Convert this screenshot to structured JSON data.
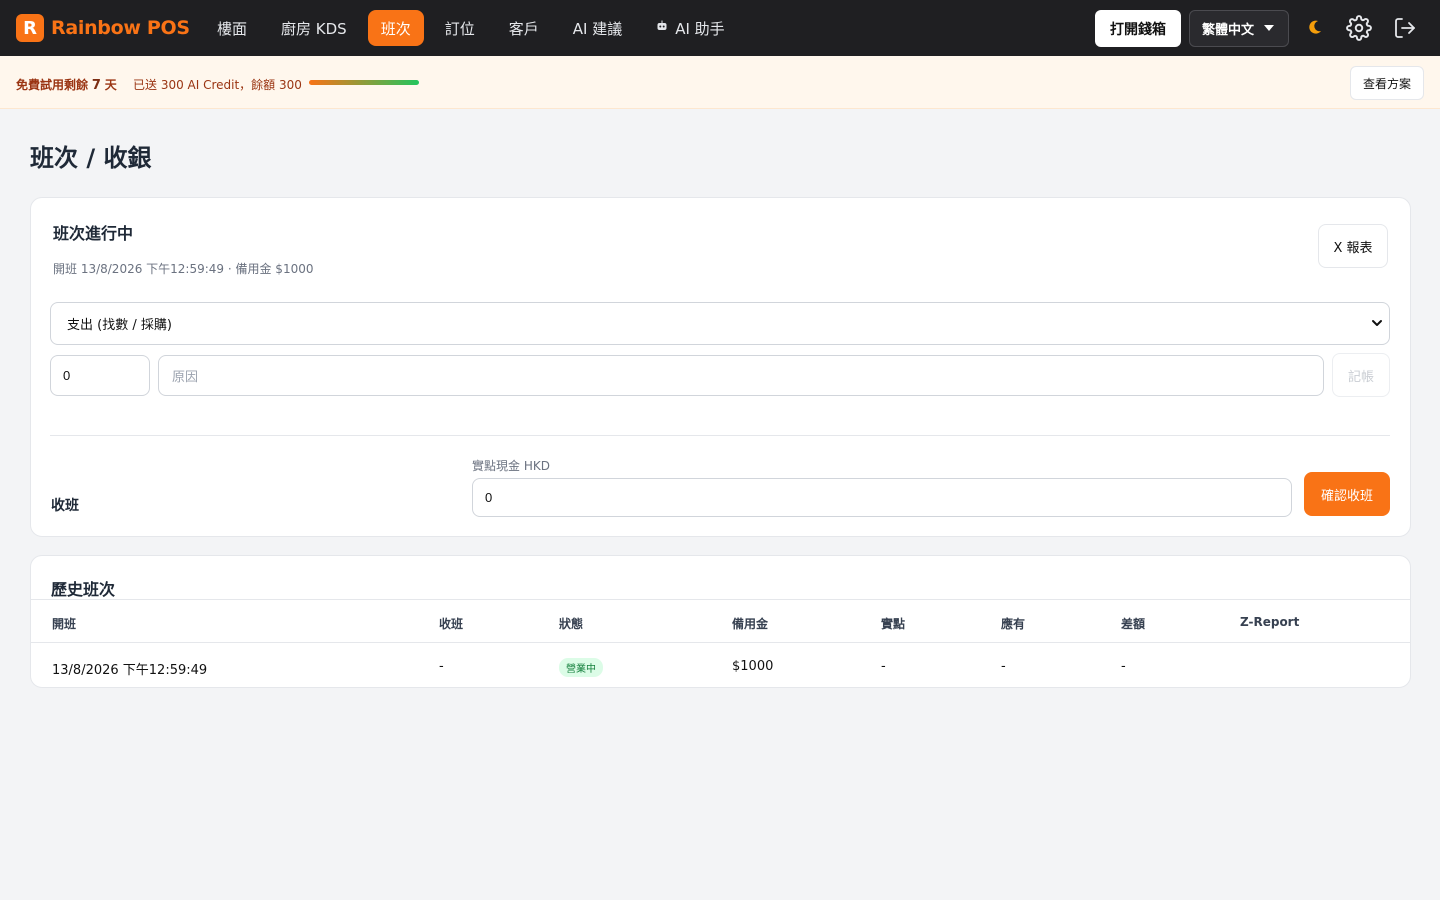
{
  "brand": {
    "name": "Rainbow POS",
    "logo_letter": "R",
    "color": "#f97316"
  },
  "nav": {
    "items": [
      {
        "label": "樓面"
      },
      {
        "label": "廚房 KDS"
      },
      {
        "label": "班次",
        "active": true
      },
      {
        "label": "訂位"
      },
      {
        "label": "客戶"
      },
      {
        "label": "AI 建議"
      },
      {
        "label": "AI 助手",
        "icon": "robot-icon"
      }
    ]
  },
  "toolbar": {
    "open_cashbox_label": "打開錢箱",
    "language_selected": "繁體中文",
    "theme_icon": "moon-icon",
    "settings_icon": "gear-icon",
    "logout_icon": "logout-icon"
  },
  "trial_banner": {
    "prefix": "免費試用剩餘",
    "days": "7",
    "suffix": "天",
    "credit_text": "已送 300 AI Credit，餘額 300",
    "credit_fraction_remaining": 1.0,
    "plans_button_label": "查看方案"
  },
  "page": {
    "title": "班次 / 收銀"
  },
  "current_shift": {
    "title": "班次進行中",
    "meta": "開班 13/8/2026 下午12:59:49 · 備用金 $1000",
    "x_report_label": "X 報表",
    "movement_type_selected": "支出 (找數 / 採購)",
    "amount_value": "0",
    "reason_placeholder": "原因",
    "record_button_label": "記帳",
    "close_section_label": "收班",
    "counted_cash_label": "實點現金 HKD",
    "counted_cash_value": "0",
    "confirm_close_label": "確認收班"
  },
  "history": {
    "title": "歷史班次",
    "columns": [
      "開班",
      "收班",
      "狀態",
      "備用金",
      "實點",
      "應有",
      "差額",
      "Z-Report"
    ],
    "rows": [
      {
        "opened": "13/8/2026 下午12:59:49",
        "closed": "-",
        "status": "營業中",
        "float": "$1000",
        "counted": "-",
        "expected": "-",
        "difference": "-",
        "z_report": ""
      }
    ]
  },
  "colors": {
    "accent": "#f97316",
    "nav_bg": "#1f1f22",
    "banner_bg": "#fff7ed",
    "status_open_bg": "#dcfce7",
    "status_open_text": "#15803d"
  }
}
